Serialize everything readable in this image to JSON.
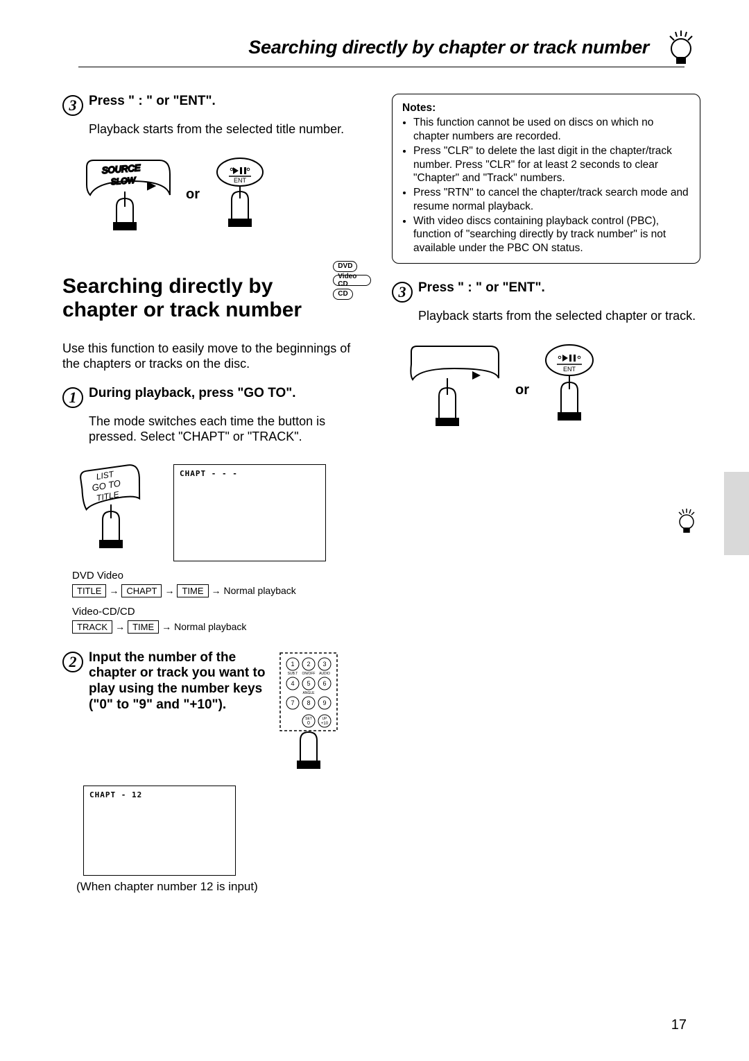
{
  "header": {
    "title": "Searching directly by chapter or track number"
  },
  "left": {
    "step3": {
      "num": "3",
      "title": "Press \"  :  \" or \"ENT\".",
      "text": "Playback starts from the selected title number.",
      "btn_source": "SOURCE",
      "btn_slow": "SLOW",
      "or": "or",
      "ent": "ENT"
    },
    "section": {
      "heading": "Searching directly by chapter or track number",
      "badges": [
        "DVD",
        "Video CD",
        "CD"
      ],
      "intro": "Use this function to easily move to the beginnings of the chapters or tracks on the disc."
    },
    "step1": {
      "num": "1",
      "title": "During playback, press \"GO TO\".",
      "text": "The mode switches each time the button is pressed.  Select \"CHAPT\" or \"TRACK\".",
      "btn_list": "LIST",
      "btn_goto": "GO TO",
      "btn_title": "TITLE",
      "display": "CHAPT  - - -",
      "chain1_label": "DVD Video",
      "chain1": [
        "TITLE",
        "CHAPT",
        "TIME"
      ],
      "chain1_end": "Normal playback",
      "chain2_label": "Video-CD/CD",
      "chain2": [
        "TRACK",
        "TIME"
      ],
      "chain2_end": "Normal playback"
    },
    "step2": {
      "num": "2",
      "title": "Input the number of the chapter or track you want to play using the number keys (\"0\" to \"9\" and \"+10\").",
      "display": "CHAPT  - 12",
      "caption": "(When chapter number 12 is input)",
      "key_subt": "SUB.T",
      "key_onoff": "ON/OFF",
      "key_audio": "AUDIO",
      "key_angle": "ANGLE",
      "key_set0": "SET\n0",
      "key_up10": "UP\n+10"
    }
  },
  "right": {
    "notes": {
      "title": "Notes:",
      "items": [
        "This function cannot be used on discs on which no chapter numbers are recorded.",
        "Press \"CLR\" to delete the last digit in the chapter/track number. Press \"CLR\"  for at least 2 seconds to clear \"Chapter\" and \"Track\" numbers.",
        "Press \"RTN\" to cancel the chapter/track search mode and resume normal playback.",
        "With video discs containing playback control (PBC), function of \"searching directly by track number\" is not available under the PBC ON status."
      ]
    },
    "step3": {
      "num": "3",
      "title": "Press \"  :  \" or \"ENT\".",
      "text": "Playback starts from the selected chapter or track.",
      "or": "or",
      "ent": "ENT"
    }
  },
  "page_number": "17"
}
